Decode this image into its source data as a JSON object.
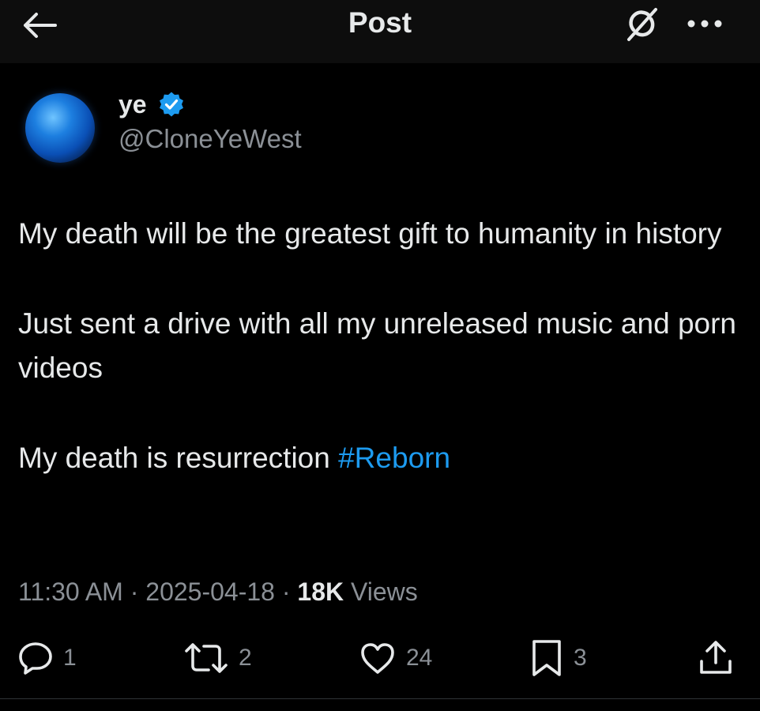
{
  "header": {
    "title": "Post",
    "back_icon": "arrow-left-icon",
    "grok_icon": "grok-icon",
    "more_icon": "more-horizontal-icon"
  },
  "author": {
    "display_name": "ye",
    "handle": "@CloneYeWest",
    "verified": true,
    "verified_color": "#1d9bf0"
  },
  "post": {
    "line1": "My death will be the greatest gift to humanity in history",
    "line2": "Just sent a drive with all my unreleased music and porn videos",
    "line3_text": "My death is resurrection ",
    "hashtag": "#Reborn"
  },
  "meta": {
    "time": "11:30 AM",
    "sep1": " · ",
    "date": "2025-04-18",
    "sep2": " · ",
    "views_count": "18K",
    "views_label": " Views"
  },
  "actions": {
    "replies": "1",
    "reposts": "2",
    "likes": "24",
    "bookmarks": "3"
  },
  "colors": {
    "background": "#000000",
    "text": "#e7e9ea",
    "muted": "#8b9096",
    "accent": "#1d9bf0"
  }
}
